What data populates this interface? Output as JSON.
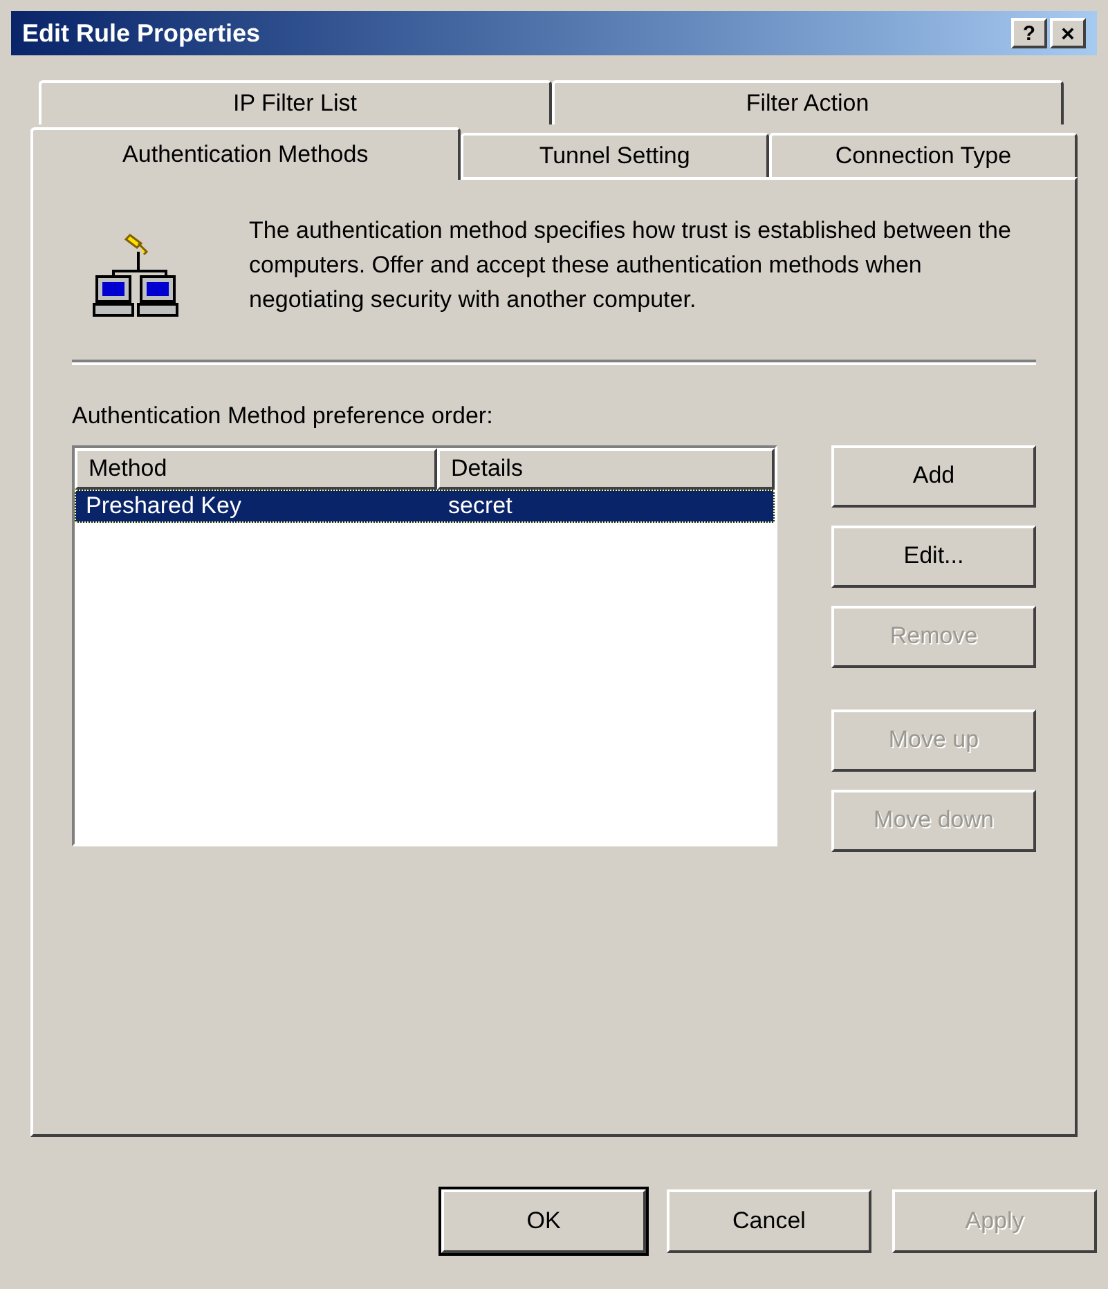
{
  "window": {
    "title": "Edit Rule Properties",
    "help": "?",
    "close": "×"
  },
  "tab_rows": [
    [
      {
        "label": "IP Filter List",
        "selected": false
      },
      {
        "label": "Filter Action",
        "selected": false
      }
    ],
    [
      {
        "label": "Authentication Methods",
        "selected": true
      },
      {
        "label": "Tunnel Setting",
        "selected": false
      },
      {
        "label": "Connection Type",
        "selected": false
      }
    ]
  ],
  "description": "The authentication method specifies how trust is established between the computers. Offer and accept these authentication methods when negotiating security with another computer.",
  "list_label": "Authentication Method preference order:",
  "table": {
    "columns": [
      "Method",
      "Details"
    ],
    "rows": [
      {
        "cells": [
          "Preshared Key",
          "secret"
        ],
        "selected": true
      }
    ]
  },
  "side_button_groups": [
    [
      {
        "label": "Add",
        "disabled": false
      },
      {
        "label": "Edit...",
        "disabled": false
      },
      {
        "label": "Remove",
        "disabled": true
      }
    ],
    [
      {
        "label": "Move up",
        "disabled": true
      },
      {
        "label": "Move down",
        "disabled": true
      }
    ]
  ],
  "footer_buttons": [
    {
      "label": "OK",
      "disabled": false,
      "default": true
    },
    {
      "label": "Cancel",
      "disabled": false,
      "default": false
    },
    {
      "label": "Apply",
      "disabled": true,
      "default": false
    }
  ]
}
